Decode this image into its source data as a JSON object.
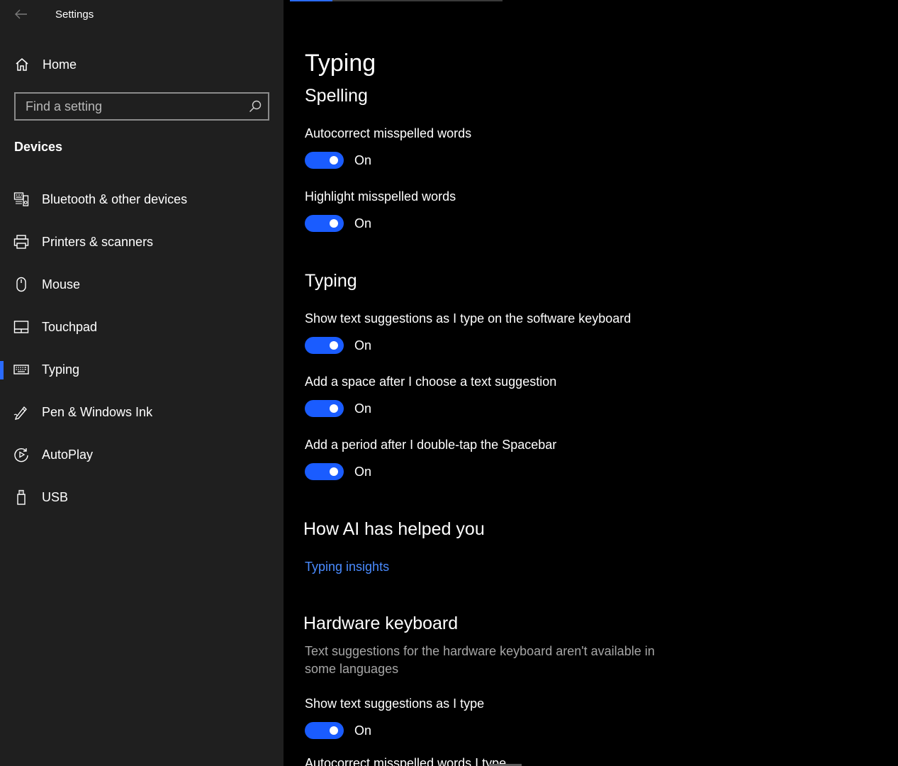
{
  "window": {
    "title": "Settings"
  },
  "sidebar": {
    "home_label": "Home",
    "search_placeholder": "Find a setting",
    "section_label": "Devices",
    "items": [
      {
        "label": "Bluetooth & other devices",
        "icon": "bluetooth-devices-icon"
      },
      {
        "label": "Printers & scanners",
        "icon": "printer-icon"
      },
      {
        "label": "Mouse",
        "icon": "mouse-icon"
      },
      {
        "label": "Touchpad",
        "icon": "touchpad-icon"
      },
      {
        "label": "Typing",
        "icon": "keyboard-icon",
        "active": true
      },
      {
        "label": "Pen & Windows Ink",
        "icon": "pen-icon"
      },
      {
        "label": "AutoPlay",
        "icon": "autoplay-icon"
      },
      {
        "label": "USB",
        "icon": "usb-icon"
      }
    ]
  },
  "main": {
    "page_title": "Typing",
    "spelling": {
      "heading": "Spelling",
      "settings": [
        {
          "label": "Autocorrect misspelled words",
          "state": "On"
        },
        {
          "label": "Highlight misspelled words",
          "state": "On"
        }
      ]
    },
    "typing": {
      "heading": "Typing",
      "settings": [
        {
          "label": "Show text suggestions as I type on the software keyboard",
          "state": "On"
        },
        {
          "label": "Add a space after I choose a text suggestion",
          "state": "On"
        },
        {
          "label": "Add a period after I double-tap the Spacebar",
          "state": "On"
        }
      ]
    },
    "ai": {
      "heading": "How AI has helped you",
      "link": "Typing insights"
    },
    "hardware": {
      "heading": "Hardware keyboard",
      "description": "Text suggestions for the hardware keyboard aren't available in some languages",
      "settings": [
        {
          "label": "Show text suggestions as I type",
          "state": "On"
        }
      ],
      "partial_next": "Autocorrect misspelled words I type"
    }
  },
  "colors": {
    "accent": "#1a5cff",
    "link": "#4a8bff",
    "sidebar_bg": "#1f1f1f",
    "main_bg": "#000000"
  }
}
